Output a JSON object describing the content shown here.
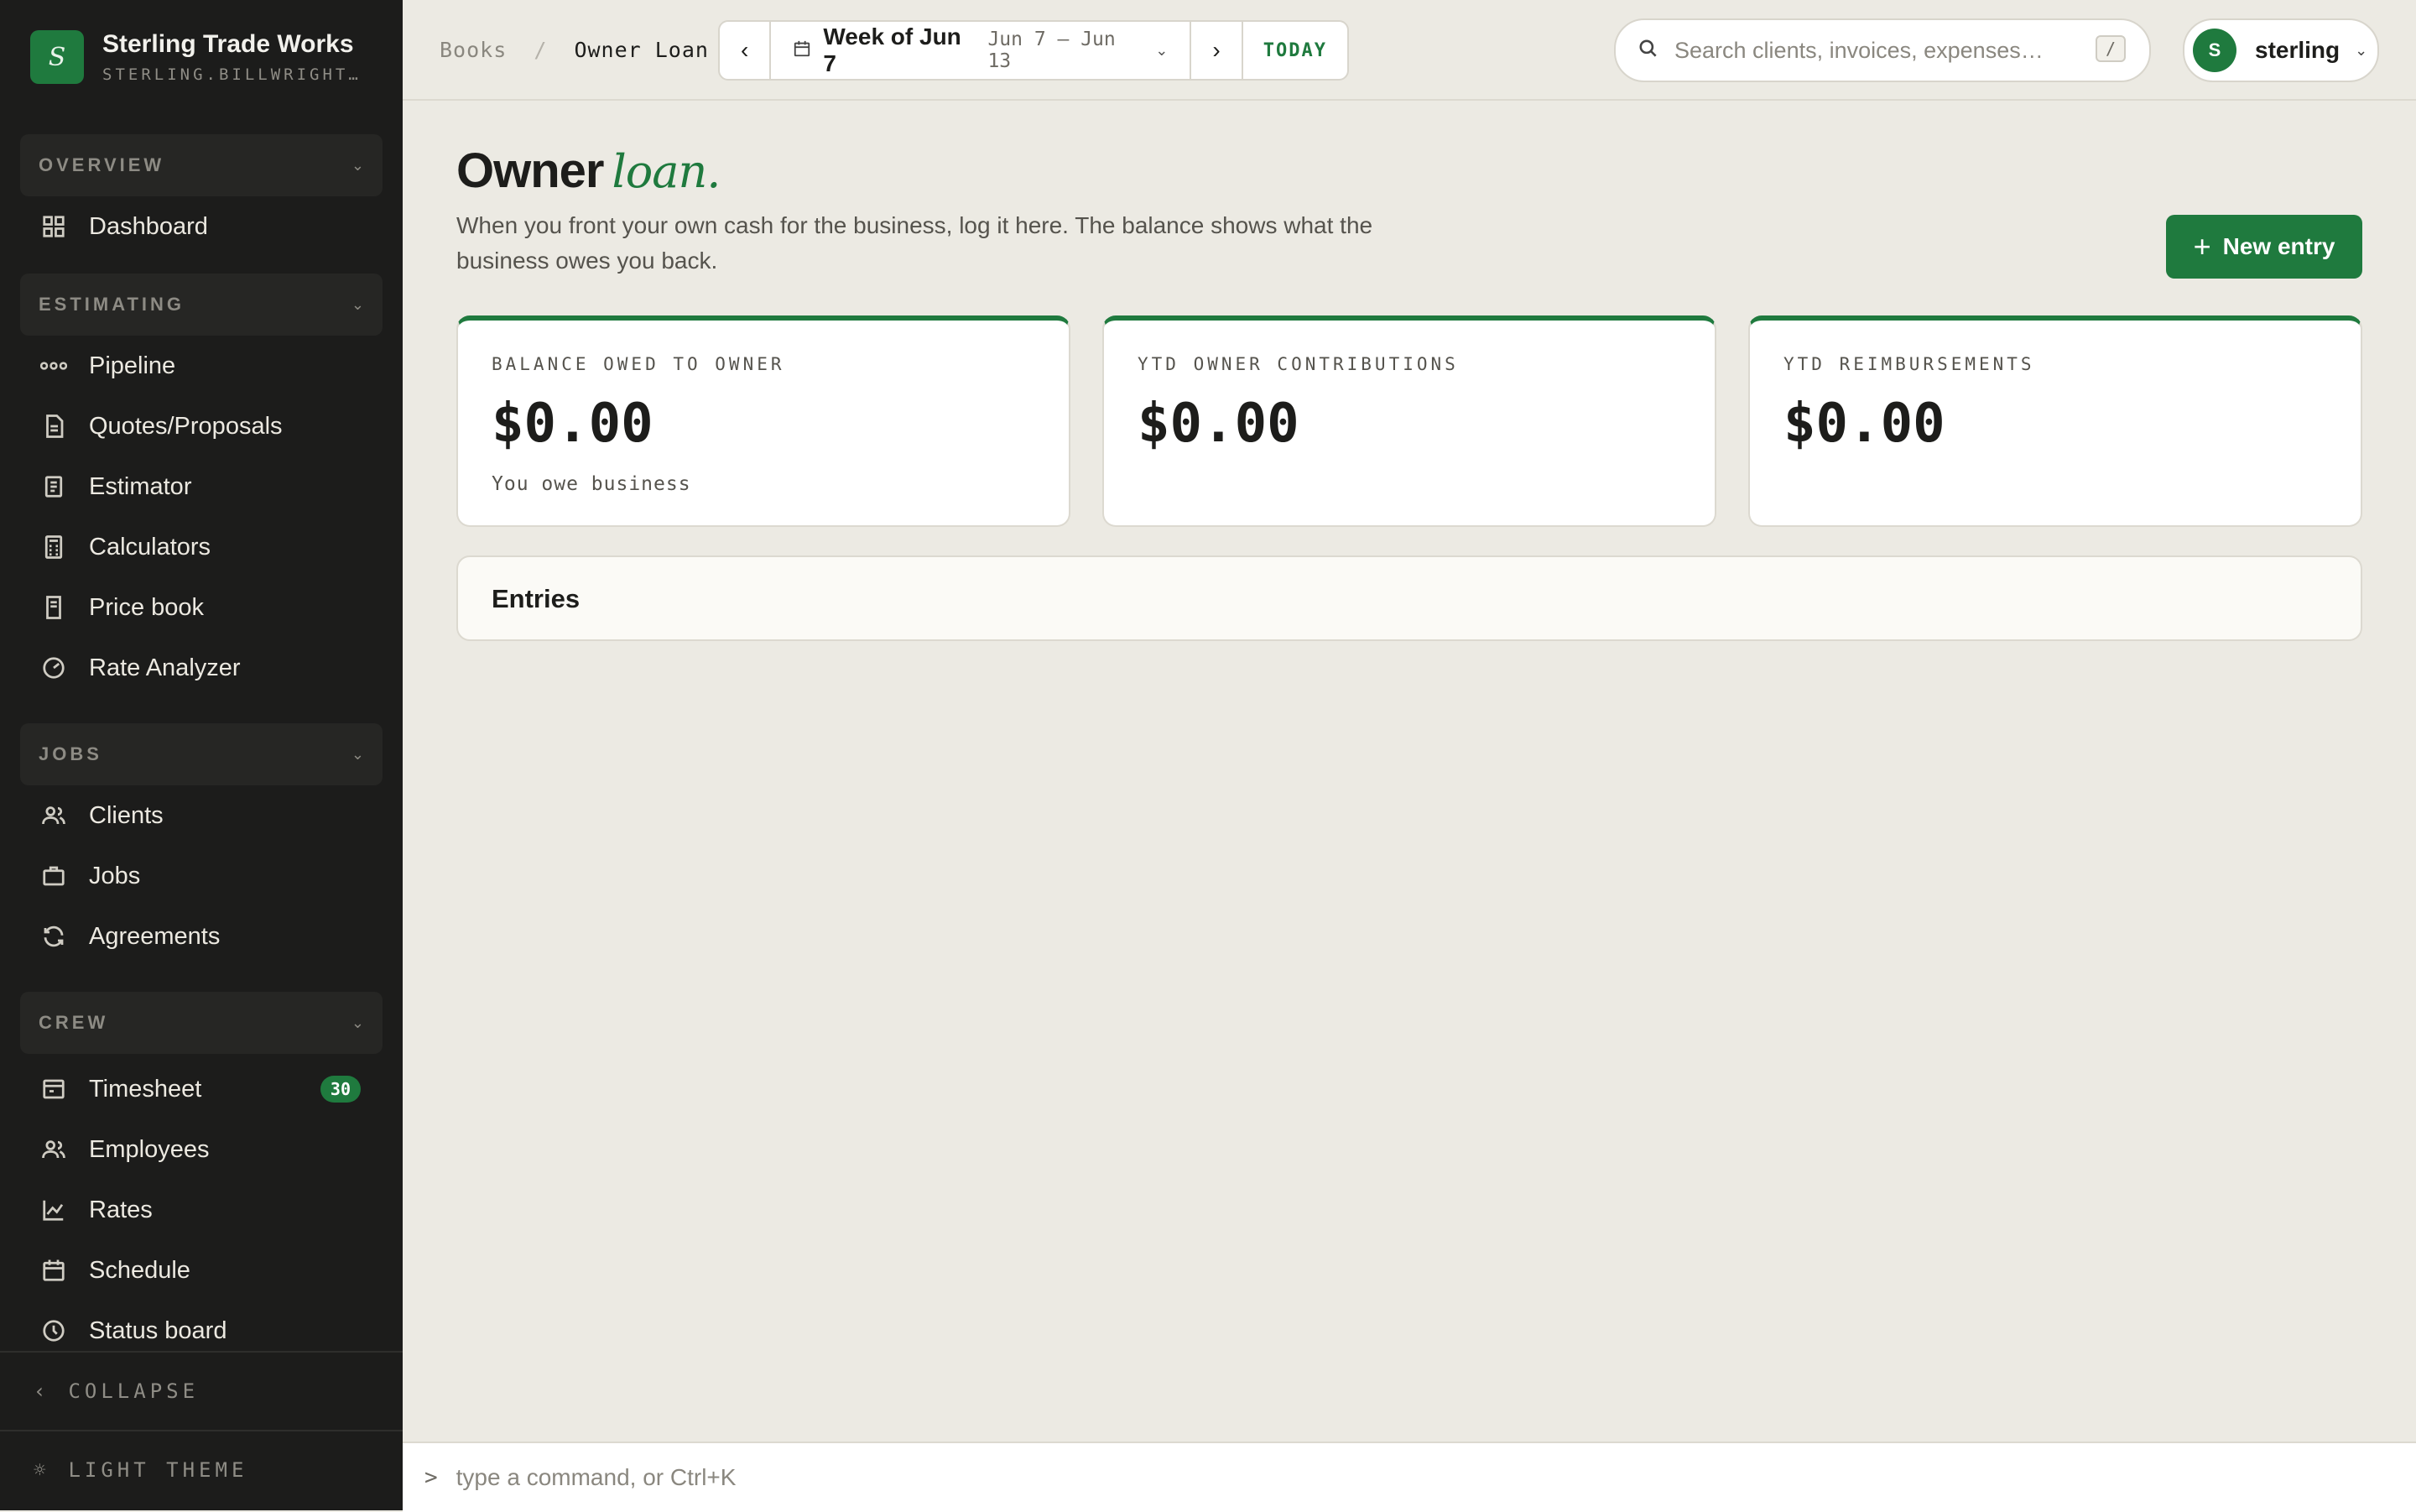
{
  "brand": {
    "initial": "S",
    "name": "Sterling Trade Works",
    "subdomain": "STERLING.BILLWRIGHT.APP"
  },
  "sidebar": {
    "sections": [
      {
        "title": "OVERVIEW",
        "items": [
          {
            "label": "Dashboard",
            "icon": "grid-icon"
          }
        ]
      },
      {
        "title": "ESTIMATING",
        "items": [
          {
            "label": "Pipeline",
            "icon": "pipeline-icon"
          },
          {
            "label": "Quotes/Proposals",
            "icon": "document-icon"
          },
          {
            "label": "Estimator",
            "icon": "clipboard-icon"
          },
          {
            "label": "Calculators",
            "icon": "calculator-icon"
          },
          {
            "label": "Price book",
            "icon": "book-icon"
          },
          {
            "label": "Rate Analyzer",
            "icon": "gauge-icon"
          }
        ]
      },
      {
        "title": "JOBS",
        "items": [
          {
            "label": "Clients",
            "icon": "users-icon"
          },
          {
            "label": "Jobs",
            "icon": "briefcase-icon"
          },
          {
            "label": "Agreements",
            "icon": "refresh-icon"
          }
        ]
      },
      {
        "title": "CREW",
        "items": [
          {
            "label": "Timesheet",
            "icon": "timesheet-icon",
            "badge": "30"
          },
          {
            "label": "Employees",
            "icon": "users-icon"
          },
          {
            "label": "Rates",
            "icon": "chart-icon"
          },
          {
            "label": "Schedule",
            "icon": "calendar-icon"
          },
          {
            "label": "Status board",
            "icon": "clock-icon"
          }
        ]
      }
    ],
    "collapse_label": "COLLAPSE",
    "theme_label": "LIGHT THEME"
  },
  "topbar": {
    "breadcrumb": {
      "parent": "Books",
      "current": "Owner Loan"
    },
    "week": {
      "label": "Week of Jun 7",
      "range": "Jun 7 – Jun 13",
      "today": "TODAY"
    },
    "search": {
      "placeholder": "Search clients, invoices, expenses…",
      "shortcut": "/"
    },
    "user": {
      "initial": "S",
      "name": "sterling"
    }
  },
  "page": {
    "title": "Owner",
    "title_accent": "loan.",
    "description": "When you front your own cash for the business, log it here. The balance shows what the business owes you back.",
    "new_entry_label": "New entry"
  },
  "stats": [
    {
      "label": "BALANCE OWED TO OWNER",
      "value": "$0.00",
      "sub": "You owe business"
    },
    {
      "label": "YTD OWNER CONTRIBUTIONS",
      "value": "$0.00",
      "sub": ""
    },
    {
      "label": "YTD REIMBURSEMENTS",
      "value": "$0.00",
      "sub": ""
    }
  ],
  "entries": {
    "title": "Entries"
  },
  "command_bar": {
    "prompt": ">",
    "placeholder": "type a command, or Ctrl+K"
  },
  "colors": {
    "accent": "#1f7a3e",
    "sidebar_bg": "#1c1c1b",
    "page_bg": "#eceae3"
  }
}
